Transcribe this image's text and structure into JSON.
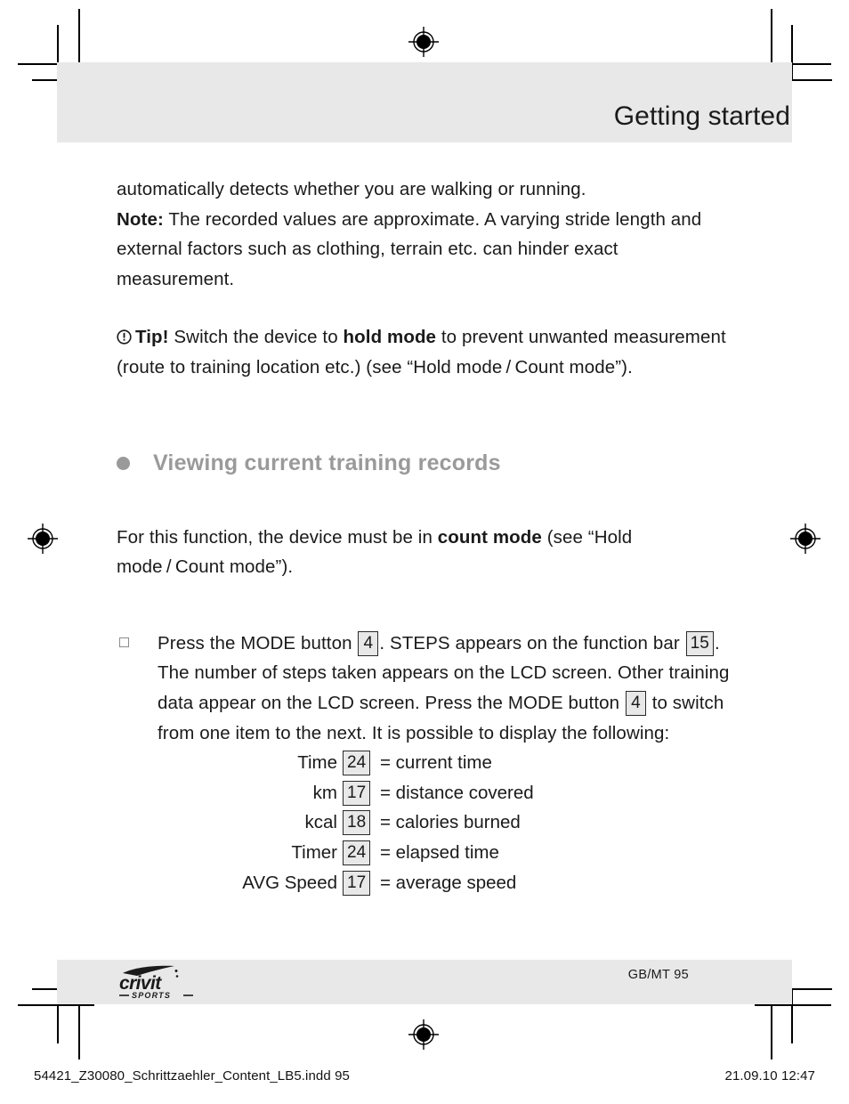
{
  "header": {
    "title": "Getting started"
  },
  "content": {
    "paragraph_1": {
      "line_1": "automatically detects whether you are walking or running.",
      "note_label": "Note:",
      "note_text": " The recorded values are approximate. A varying stride length and external factors such as clothing, terrain etc. can hinder exact measurement."
    },
    "paragraph_tip": {
      "icon": "exclamation-circle-icon",
      "tip_label": "Tip!",
      "text_before": " Switch the device to ",
      "bold_term": "hold mode",
      "text_after": " to prevent unwanted measurement (route to training location etc.) (see “Hold mode / Count mode”)."
    },
    "section_heading": {
      "bullet": "filled-circle-bullet",
      "text": "Viewing current training records"
    },
    "paragraph_2": {
      "text_before": "For this function, the device must be in ",
      "bold_term": "count mode",
      "text_after": " (see “Hold mode / Count mode”)."
    },
    "step": {
      "marker": "square-bullet",
      "seg_1": "Press the MODE button ",
      "ref_1": "4",
      "seg_2": ". STEPS appears on the function bar ",
      "ref_2": "15",
      "seg_3": ". The number of steps taken appears on the LCD screen. Other training data appear on the LCD screen. Press the MODE button ",
      "ref_3": "4",
      "seg_4": " to switch from one item to the next. It is possible to display the following:"
    },
    "definitions": [
      {
        "label": "Time",
        "ref": "24",
        "description": "= current time"
      },
      {
        "label": "km",
        "ref": "17",
        "description": "= distance covered"
      },
      {
        "label": "kcal",
        "ref": "18",
        "description": "= calories burned"
      },
      {
        "label": "Timer",
        "ref": "24",
        "description": "= elapsed time"
      },
      {
        "label": "AVG Speed",
        "ref": "17",
        "description": "= average speed"
      }
    ]
  },
  "footer": {
    "logo_name": "crivit",
    "logo_sub": "— SPORTS —",
    "page_info": "GB/MT   95"
  },
  "print_slug": {
    "left": "54421_Z30080_Schrittzaehler_Content_LB5.indd   95",
    "right": "21.09.10   12:47"
  },
  "colors": {
    "band_gray": "#e8e8e8",
    "heading_gray": "#9a9a9a",
    "text_black": "#1a1a1a",
    "refbox_fill": "#e8e8e8"
  }
}
